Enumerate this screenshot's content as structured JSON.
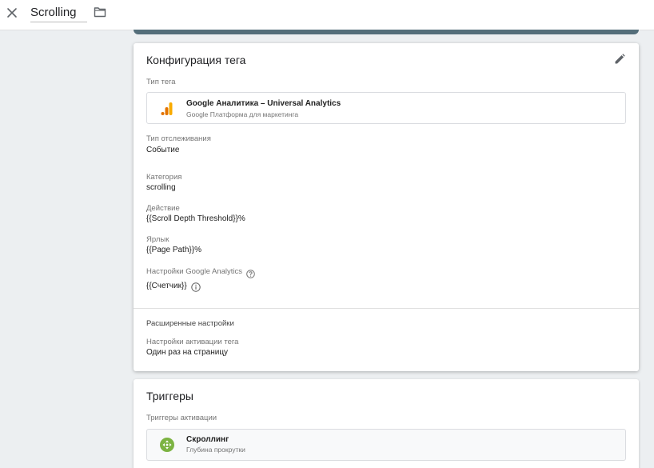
{
  "header": {
    "title": "Scrolling",
    "close_icon": "close-icon",
    "folder_icon": "folder-icon"
  },
  "tag_config": {
    "heading": "Конфигурация тега",
    "edit_icon": "pencil-icon",
    "tag_type_label": "Тип тега",
    "tag_type_name": "Google Аналитика – Universal Analytics",
    "tag_type_sub": "Google Платформа для маркетинга",
    "tracking_type_label": "Тип отслеживания",
    "tracking_type_value": "Событие",
    "category_label": "Категория",
    "category_value": "scrolling",
    "action_label": "Действие",
    "action_value": "{{Scroll Depth Threshold}}%",
    "label_label": "Ярлык",
    "label_value": "{{Page Path}}%",
    "ga_settings_label": "Настройки Google Analytics",
    "ga_settings_value": "{{Счетчик}}",
    "advanced_heading": "Расширенные настройки",
    "firing_label": "Настройки активации тега",
    "firing_value": "Один раз на страницу"
  },
  "triggers": {
    "heading": "Триггеры",
    "firing_label": "Триггеры активации",
    "trigger_name": "Скроллинг",
    "trigger_sub": "Глубина прокрутки"
  },
  "colors": {
    "accent_strip": "#546e7a",
    "ga_orange": "#f9ab00",
    "ga_dark_orange": "#e37400",
    "trigger_green": "#7cb342"
  }
}
